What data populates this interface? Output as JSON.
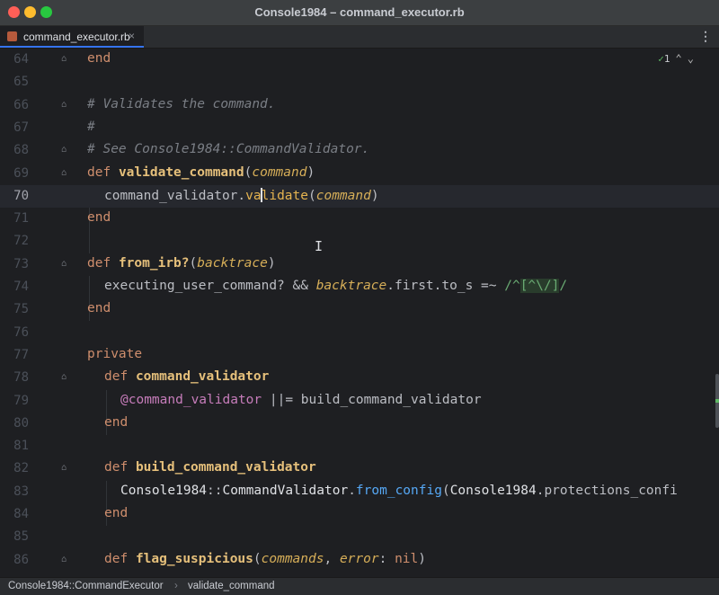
{
  "window": {
    "title": "Console1984 – command_executor.rb"
  },
  "tab": {
    "label": "command_executor.rb",
    "close": "×",
    "menu": "⋮"
  },
  "inspections": {
    "count": "1",
    "ok_glyph": "✓",
    "up": "⌃",
    "down": "⌄"
  },
  "lines": [
    {
      "n": "64"
    },
    {
      "n": "65"
    },
    {
      "n": "66"
    },
    {
      "n": "67"
    },
    {
      "n": "68"
    },
    {
      "n": "69"
    },
    {
      "n": "70"
    },
    {
      "n": "71"
    },
    {
      "n": "72"
    },
    {
      "n": "73"
    },
    {
      "n": "74"
    },
    {
      "n": "75"
    },
    {
      "n": "76"
    },
    {
      "n": "77"
    },
    {
      "n": "78"
    },
    {
      "n": "79"
    },
    {
      "n": "80"
    },
    {
      "n": "81"
    },
    {
      "n": "82"
    },
    {
      "n": "83"
    },
    {
      "n": "84"
    },
    {
      "n": "85"
    },
    {
      "n": "86"
    }
  ],
  "code": {
    "l64": {
      "kw": "end"
    },
    "l66": {
      "comment": "# Validates the command."
    },
    "l67": {
      "comment": "#"
    },
    "l68": {
      "comment": "# See Console1984::CommandValidator."
    },
    "l69": {
      "kw": "def",
      "name": "validate_command",
      "open": "(",
      "param": "command",
      "close": ")"
    },
    "l70": {
      "recv": "command_validator.",
      "call_a": "va",
      "call_b": "lidate",
      "open": "(",
      "param": "command",
      "close": ")"
    },
    "l71": {
      "kw": "end"
    },
    "l73": {
      "kw": "def",
      "name": "from_irb?",
      "open": "(",
      "param": "backtrace",
      "close": ")"
    },
    "l74": {
      "a": "executing_user_command? && ",
      "param": "backtrace",
      "b": ".first.to_s =~ ",
      "re_open": "/^",
      "re_class": "[^\\/]",
      "re_close": "/"
    },
    "l75": {
      "kw": "end"
    },
    "l77": {
      "kw": "private"
    },
    "l78": {
      "kw": "def",
      "name": "command_validator"
    },
    "l79": {
      "ivar": "@command_validator",
      "rest": " ||= build_command_validator"
    },
    "l80": {
      "kw": "end"
    },
    "l82": {
      "kw": "def",
      "name": "build_command_validator"
    },
    "l83": {
      "cls": "Console1984",
      "sep": "::",
      "cls2": "CommandValidator",
      "dot": ".",
      "call": "from_config",
      "open": "(",
      "cls3": "Console1984",
      "rest": ".protections_confi"
    },
    "l84": {
      "kw": "end"
    },
    "l86": {
      "kw": "def",
      "name": "flag_suspicious",
      "open": "(",
      "param": "commands",
      "comma": ", ",
      "param2": "error",
      "colon": ": ",
      "nil": "nil",
      "close": ")"
    }
  },
  "status": {
    "crumb1": "Console1984::CommandExecutor",
    "sep": "›",
    "crumb2": "validate_command"
  },
  "colors": {
    "keyword": "#cf8e6d",
    "method_name": "#e6c07b",
    "param": "#d6ae58",
    "comment": "#7a7e85",
    "ivar": "#c77dbb",
    "regex": "#6aab73"
  }
}
